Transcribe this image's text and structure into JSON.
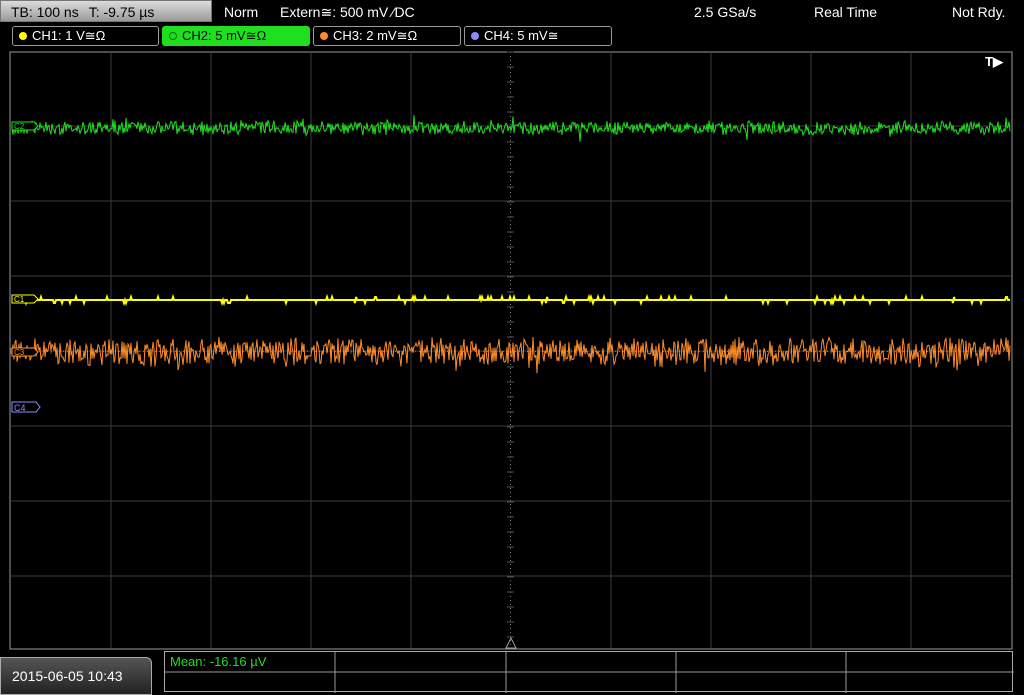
{
  "status": {
    "timebase": "TB: 100 ns",
    "trigger_time": "T: -9.75 µs",
    "mode": "Norm",
    "trigger_source": "Extern≅: 500 mV ⁄DC",
    "sample_rate": "2.5 GSa/s",
    "acq_mode": "Real Time",
    "state": "Not Rdy."
  },
  "channels": [
    {
      "label": "CH1: 1 V≅Ω",
      "color": "#ffff00",
      "marker": "C1"
    },
    {
      "label": "CH2: 5 mV≅Ω",
      "color": "#1fe01f",
      "marker": "C2"
    },
    {
      "label": "CH3: 2 mV≅Ω",
      "color": "#ff8c28",
      "marker": "C3"
    },
    {
      "label": "CH4: 5 mV≅",
      "color": "#8c8cff",
      "marker": "C4"
    }
  ],
  "trigger_marker": "T▶",
  "measurement": {
    "label": "Mean: -16.16 µV"
  },
  "datetime": "2015-06-05 10:43",
  "colors": {
    "grid": "#3c3c3c",
    "ch1": "#ffff00",
    "ch2": "#1fe01f",
    "ch3": "#ff8c28",
    "ch4": "#8c8cff"
  }
}
